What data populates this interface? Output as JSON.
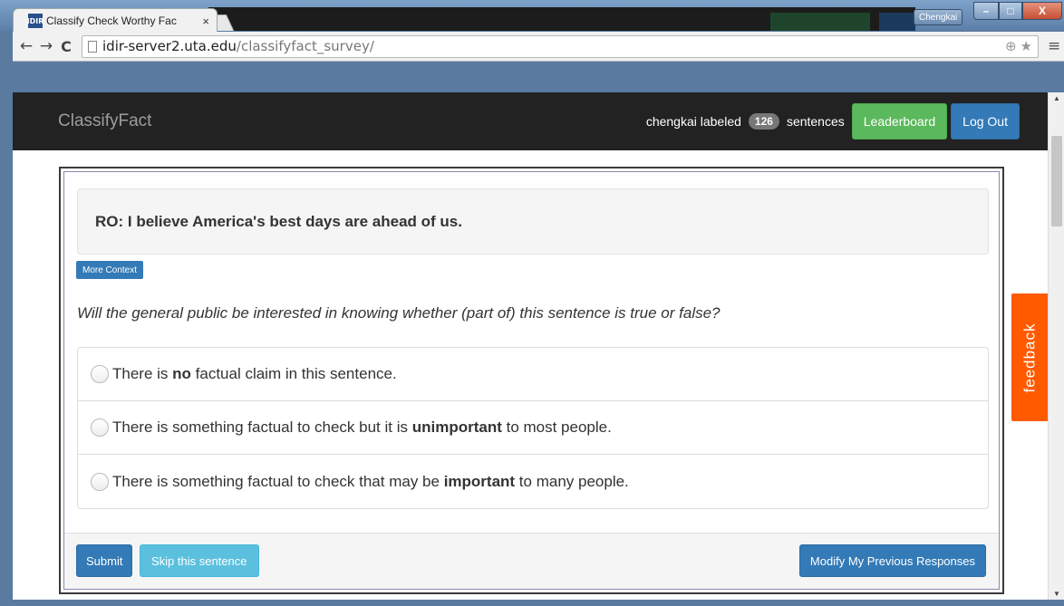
{
  "window": {
    "user_label": "Chengkai",
    "min_icon": "–",
    "max_icon": "□",
    "close_icon": "X"
  },
  "tab": {
    "favicon_text": "IDIR",
    "title": "Classify Check Worthy Fac",
    "close_icon": "×"
  },
  "toolbar": {
    "back_icon": "←",
    "forward_icon": "→",
    "reload_icon": "C",
    "url_host": "idir-server2.uta.edu",
    "url_path": "/classifyfact_survey/",
    "zoom_icon": "⊕",
    "star_icon": "★",
    "menu_icon": "≡"
  },
  "navbar": {
    "brand": "ClassifyFact",
    "user_text": "chengkai labeled",
    "count": "126",
    "suffix_text": "sentences",
    "leaderboard_label": "Leaderboard",
    "logout_label": "Log Out"
  },
  "main": {
    "sentence": "RO: I believe America's best days are ahead of us.",
    "more_context_label": "More Context",
    "question": "Will the general public be interested in knowing whether (part of) this sentence is true or false?",
    "options": [
      {
        "before": "There is ",
        "bold": "no",
        "after": " factual claim in this sentence."
      },
      {
        "before": "There is something factual to check but it is ",
        "bold": "unimportant",
        "after": " to most people."
      },
      {
        "before": "There is something factual to check that may be ",
        "bold": "important",
        "after": " to many people."
      }
    ],
    "submit_label": "Submit",
    "skip_label": "Skip this sentence",
    "modify_label": "Modify My Previous Responses"
  },
  "feedback": {
    "label": "feedback"
  },
  "colors": {
    "navbar_bg": "#222222",
    "primary": "#337ab7",
    "success": "#5cb85c",
    "info": "#5bc0de",
    "feedback": "#ff5a00"
  }
}
